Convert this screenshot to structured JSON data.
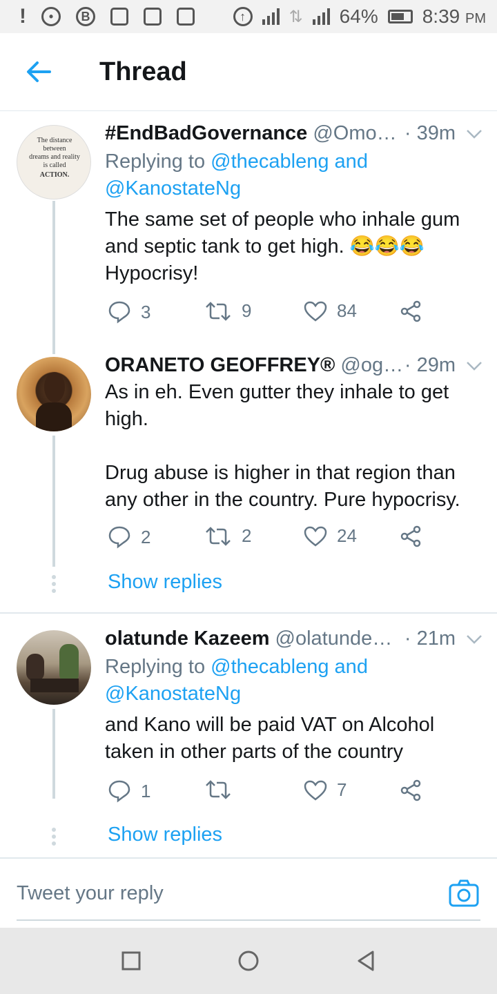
{
  "status_bar": {
    "battery": "64%",
    "time": "8:39",
    "ampm": "PM"
  },
  "header": {
    "title": "Thread"
  },
  "tweets": [
    {
      "name": "#EndBadGovernance",
      "handle": "@Omo…",
      "time": "· 39m",
      "reply_prefix": "Replying to ",
      "mention_1": "@thecableng",
      "and": " and",
      "mention_2": "@KanostateNg",
      "text": "The same set of people who inhale gum and septic tank to get high. 😂😂😂\nHypocrisy!",
      "replies": "3",
      "retweets": "9",
      "likes": "84",
      "avatar_text": {
        "line1": "The distance",
        "line2": "between",
        "line3": "dreams and reality",
        "line4": "is called",
        "line5": "ACTION."
      }
    },
    {
      "name": "ORANETO GEOFFREY®",
      "handle": "@og…",
      "time": "· 29m",
      "text": "As in eh. Even gutter they inhale to get high.\n\nDrug abuse is higher in that region than any other in the country. Pure hypocrisy.",
      "replies": "2",
      "retweets": "2",
      "likes": "24",
      "show_replies": "Show replies"
    },
    {
      "name": "olatunde Kazeem",
      "handle": "@olatunde…",
      "time": "· 21m",
      "reply_prefix": "Replying to ",
      "mention_1": "@thecableng",
      "and": " and",
      "mention_2": "@KanostateNg",
      "text": "and Kano will be paid VAT on Alcohol taken in other parts of the country",
      "replies": "1",
      "retweets": "",
      "likes": "7",
      "show_replies": "Show replies"
    }
  ],
  "compose": {
    "placeholder": "Tweet your reply"
  },
  "colors": {
    "accent": "#1da1f2",
    "secondary_text": "#657786",
    "divider": "#e1e8ed"
  },
  "icons": [
    "back-arrow-icon",
    "chevron-down-icon",
    "reply-icon",
    "retweet-icon",
    "like-icon",
    "share-icon",
    "camera-icon",
    "nav-recents-icon",
    "nav-home-icon",
    "nav-back-icon"
  ]
}
